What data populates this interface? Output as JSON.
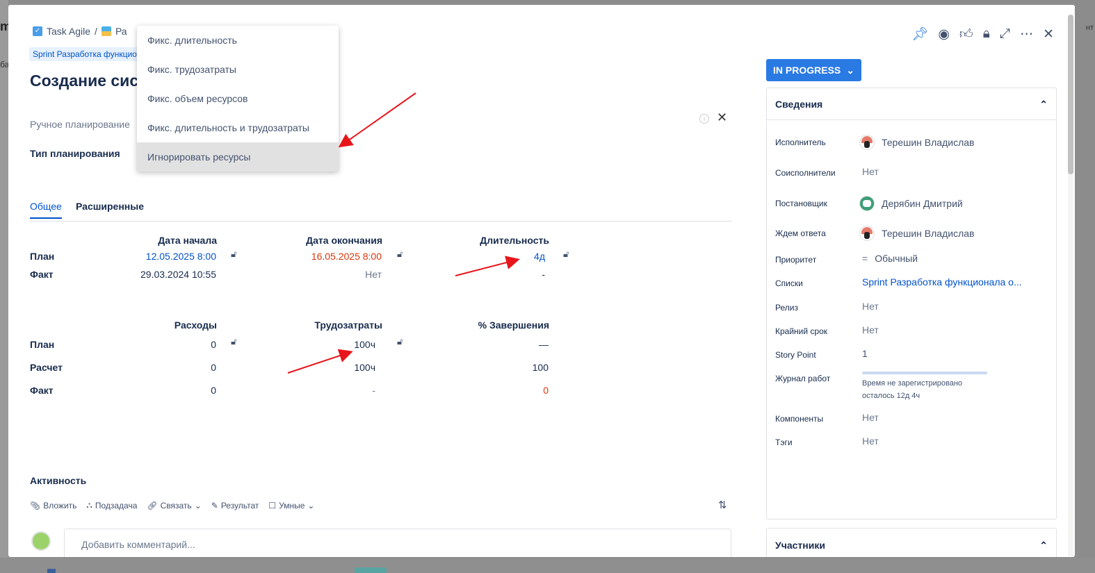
{
  "background": {
    "left_text": "m",
    "left_text2": "ба",
    "right_text": "нт"
  },
  "breadcrumb": {
    "project": "Task Agile",
    "separator": "/",
    "next": "Ра"
  },
  "sprint_tag": "Sprint Разработка функцион",
  "task_title": "Создание сист",
  "planning": {
    "manual_label": "Ручное планирование",
    "type_label": "Тип планирования"
  },
  "dropdown": {
    "options": [
      "Фикс. длительность",
      "Фикс. трудозатраты",
      "Фикс. объем ресурсов",
      "Фикс. длительность и трудозатраты",
      "Игнорировать ресурсы"
    ],
    "highlighted_index": 4
  },
  "tabs": [
    "Общее",
    "Расширенные"
  ],
  "schedule": {
    "headers": [
      "Дата начала",
      "Дата окончания",
      "Длительность"
    ],
    "rows": [
      {
        "label": "План",
        "start": "12.05.2025 8:00",
        "end": "16.05.2025 8:00",
        "duration": "4д"
      },
      {
        "label": "Факт",
        "start": "29.03.2024 10:55",
        "end": "Нет",
        "duration": "-"
      }
    ]
  },
  "costs": {
    "headers": [
      "Расходы",
      "Трудозатраты",
      "% Завершения"
    ],
    "rows": [
      {
        "label": "План",
        "expenses": "0",
        "labor": "100ч",
        "completion": "—"
      },
      {
        "label": "Расчет",
        "expenses": "0",
        "labor": "100ч",
        "completion": "100"
      },
      {
        "label": "Факт",
        "expenses": "0",
        "labor": "-",
        "completion": "0"
      }
    ]
  },
  "activity": {
    "title": "Активность",
    "toolbar": [
      "Вложить",
      "Подзадача",
      "Связать",
      "Результат",
      "Умные"
    ],
    "comment_placeholder": "Добавить комментарий..."
  },
  "status": "IN PROGRESS",
  "details": {
    "title": "Сведения",
    "fields": [
      {
        "label": "Исполнитель",
        "value": "Терешин Владислав"
      },
      {
        "label": "Соисполнители",
        "value": "Нет"
      },
      {
        "label": "Постановщик",
        "value": "Дерябин Дмитрий"
      },
      {
        "label": "Ждем ответа",
        "value": "Терешин Владислав"
      },
      {
        "label": "Приоритет",
        "value": "Обычный"
      },
      {
        "label": "Списки",
        "value": "Sprint Разработка функционала о..."
      },
      {
        "label": "Релиз",
        "value": "Нет"
      },
      {
        "label": "Крайний срок",
        "value": "Нет"
      },
      {
        "label": "Story Point",
        "value": "1"
      },
      {
        "label": "Журнал работ",
        "value": "Время не зарегистрировано",
        "value2": "осталось 12д 4ч"
      },
      {
        "label": "Компоненты",
        "value": "Нет"
      },
      {
        "label": "Тэги",
        "value": "Нет"
      }
    ]
  },
  "participants": {
    "title": "Участники"
  },
  "colors": {
    "accent": "#0052cc",
    "status_bg": "#2a7ae4",
    "overdue": "#de350b",
    "annotation": "#e8151b"
  }
}
